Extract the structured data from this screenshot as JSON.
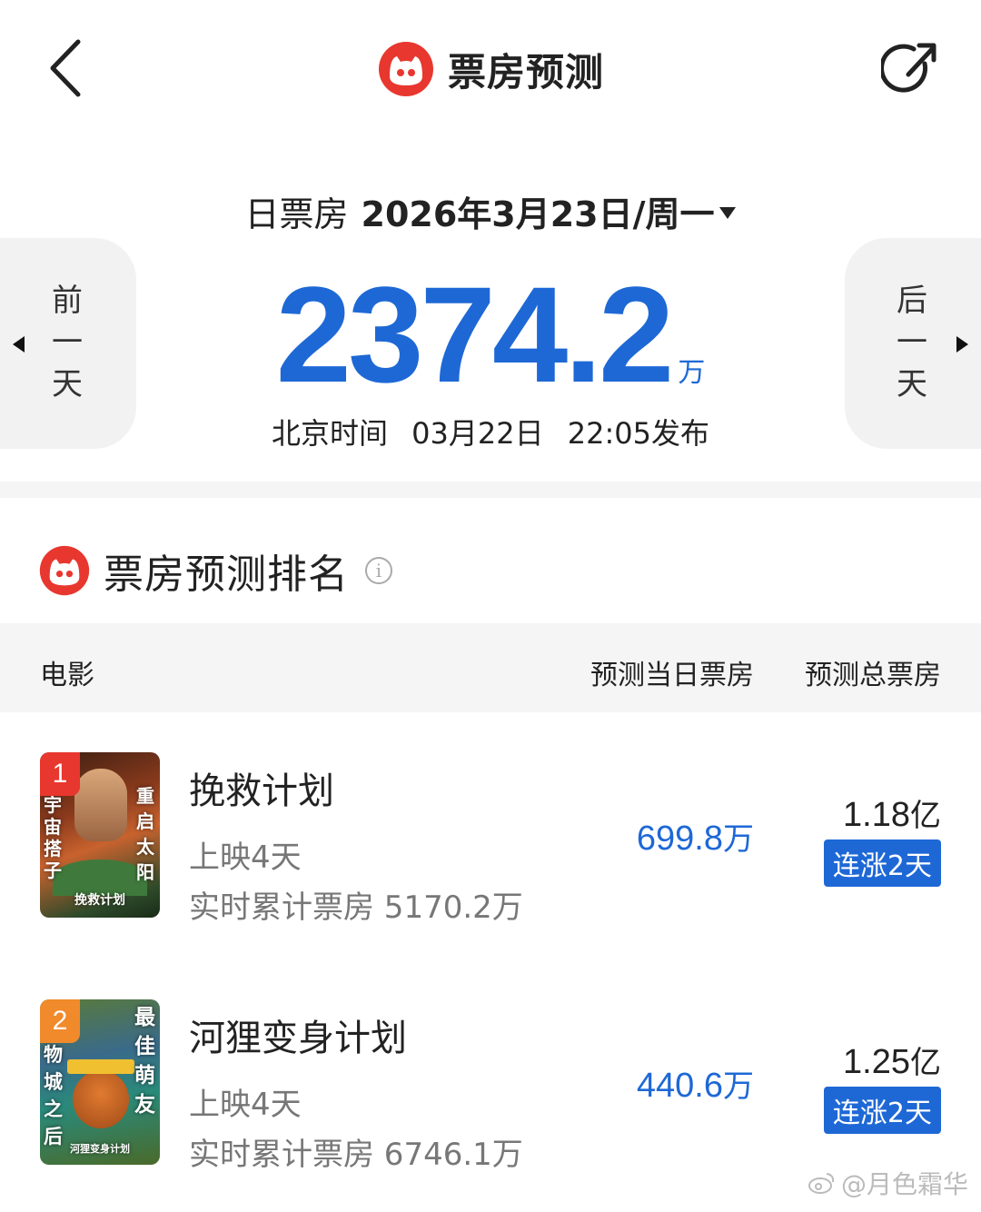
{
  "header": {
    "title": "票房预测",
    "back_icon": "chevron-left-icon",
    "share_icon": "share-icon"
  },
  "date_bar": {
    "label": "日票房",
    "date": "2026年3月23日/周一"
  },
  "nav": {
    "prev": [
      "前",
      "一",
      "天"
    ],
    "next": [
      "后",
      "一",
      "天"
    ]
  },
  "forecast": {
    "value": "2374.2",
    "unit": "万",
    "publish_prefix": "北京时间",
    "publish_date": "03月22日",
    "publish_time": "22:05发布"
  },
  "ranking": {
    "title": "票房预测排名",
    "info_icon": "i",
    "columns": {
      "movie": "电影",
      "day_box": "预测当日票房",
      "total_box": "预测总票房"
    },
    "movies": [
      {
        "rank": "1",
        "title": "挽救计划",
        "days": "上映4天",
        "cumulative": "实时累计票房 5170.2万",
        "day_box_value": "699.8",
        "day_box_unit": "万",
        "total_value": "1.18",
        "total_unit": "亿",
        "trend": "连涨2天",
        "poster_left": "宇宙搭子",
        "poster_right": "重启太阳",
        "poster_bottom": "挽救计划"
      },
      {
        "rank": "2",
        "title": "河狸变身计划",
        "days": "上映4天",
        "cumulative": "实时累计票房 6746.1万",
        "day_box_value": "440.6",
        "day_box_unit": "万",
        "total_value": "1.25",
        "total_unit": "亿",
        "trend": "连涨2天",
        "poster_left": "物城之后",
        "poster_right": "最佳萌友",
        "poster_bottom": "河狸变身计划"
      }
    ]
  },
  "watermark": "@月色霜华",
  "colors": {
    "accent_blue": "#1e68d6",
    "brand_red": "#e8372f",
    "rank1_badge": "#e8372f",
    "rank2_badge": "#f08a2a"
  }
}
